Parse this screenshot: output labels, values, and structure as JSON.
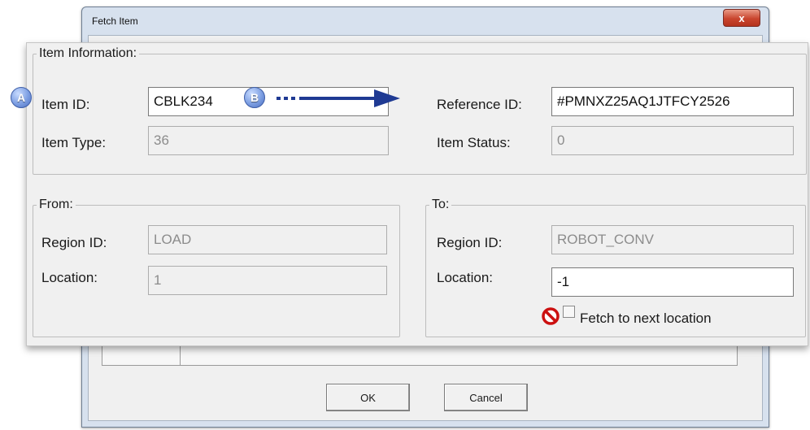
{
  "window": {
    "title": "Fetch Item",
    "close_glyph": "x",
    "ok_label": "OK",
    "cancel_label": "Cancel"
  },
  "item_info": {
    "legend": "Item Information:",
    "item_id_label": "Item ID:",
    "item_id_value": "CBLK234",
    "item_type_label": "Item Type:",
    "item_type_value": "36",
    "reference_id_label": "Reference ID:",
    "reference_id_value": "#PMNXZ25AQ1JTFCY2526",
    "item_status_label": "Item Status:",
    "item_status_value": "0"
  },
  "from": {
    "legend": "From:",
    "region_id_label": "Region ID:",
    "region_id_value": "LOAD",
    "location_label": "Location:",
    "location_value": "1"
  },
  "to": {
    "legend": "To:",
    "region_id_label": "Region ID:",
    "region_id_value": "ROBOT_CONV",
    "location_label": "Location:",
    "location_value": "-1",
    "fetch_next_label": "Fetch to next location",
    "fetch_next_checked": false
  },
  "callouts": {
    "a": "A",
    "b": "B",
    "badge_color": "#5b7ed0",
    "arrow_color": "#1f3a93",
    "no_icon_color": "#cc1010"
  }
}
